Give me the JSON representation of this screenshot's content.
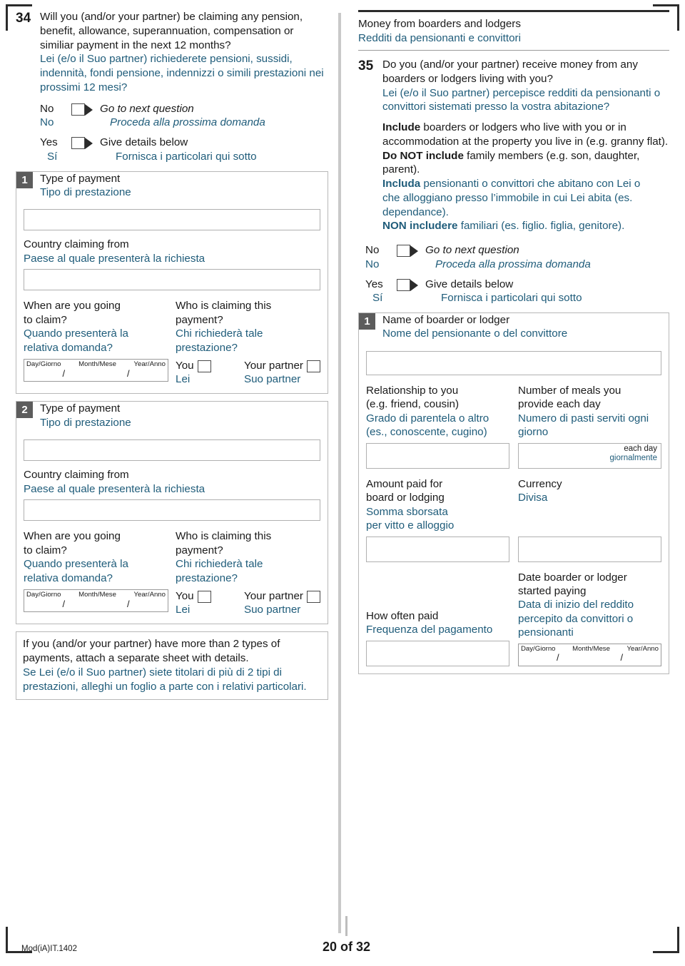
{
  "document": {
    "form_code": "Mod(iA)IT.1402",
    "page_label": "20 of 32"
  },
  "colors": {
    "english_text": "#1a1a1a",
    "italian_text": "#1f5c7a",
    "badge_background": "#5c5c5c",
    "panel_border": "#b8b8b8"
  },
  "left_column": {
    "question": {
      "number": "34",
      "en_line1": "Will you (and/or your partner) be claiming any pension,",
      "en_line2": "benefit, allowance, superannuation, compensation or",
      "en_line3": "similiar payment in the next 12 months?",
      "it_line1": "Lei (e/o il Suo partner) richiederete pensioni, sussidi,",
      "it_line2": "indennità, fondi pensione, indennizzi o simili prestazioni nei",
      "it_line3": "prossimi 12 mesi?"
    },
    "answers": {
      "no_en": "No",
      "no_it": "No",
      "no_action_en": "Go to next question",
      "no_action_it": "Proceda alla prossima domanda",
      "yes_en": "Yes",
      "yes_it": "Sí",
      "yes_action_en": "Give details below",
      "yes_action_it": "Fornisca i particolari qui sotto"
    },
    "entry_1": {
      "badge": "1",
      "type_en": "Type of payment",
      "type_it": "Tipo di prestazione",
      "type_value": "",
      "country_en": "Country claiming from",
      "country_it": "Paese al quale presenterà la richiesta",
      "country_value": "",
      "when_en_line1": "When are you going",
      "when_en_line2": "to claim?",
      "when_it_line1": "Quando presenterà la",
      "when_it_line2": "relativa domanda?",
      "date_day": "Day/Giorno",
      "date_month": "Month/Mese",
      "date_year": "Year/Anno",
      "date_value_day": "",
      "date_value_month": "",
      "date_value_year": "",
      "who_en_line1": "Who is claiming this",
      "who_en_line2": "payment?",
      "who_it_line1": "Chi richiederà tale",
      "who_it_line2": "prestazione?",
      "you_en": "You",
      "you_it": "Lei",
      "partner_en": "Your partner",
      "partner_it": "Suo partner"
    },
    "entry_2": {
      "badge": "2",
      "type_en": "Type of payment",
      "type_it": "Tipo di prestazione",
      "type_value": "",
      "country_en": "Country claiming from",
      "country_it": "Paese al quale presenterà la richiesta",
      "country_value": "",
      "when_en_line1": "When are you going",
      "when_en_line2": "to claim?",
      "when_it_line1": "Quando presenterà la",
      "when_it_line2": "relativa domanda?",
      "date_day": "Day/Giorno",
      "date_month": "Month/Mese",
      "date_year": "Year/Anno",
      "date_value_day": "",
      "date_value_month": "",
      "date_value_year": "",
      "who_en_line1": "Who is claiming this",
      "who_en_line2": "payment?",
      "who_it_line1": "Chi richiederà tale",
      "who_it_line2": "prestazione?",
      "you_en": "You",
      "you_it": "Lei",
      "partner_en": "Your partner",
      "partner_it": "Suo partner"
    },
    "note": {
      "en_line1": "If you (and/or your partner) have more than 2 types of",
      "en_line2": "payments, attach a separate sheet with details.",
      "it_line1": "Se Lei (e/o il Suo partner) siete titolari di più di 2 tipi di",
      "it_line2": "prestazioni, alleghi un foglio a parte con i relativi particolari."
    }
  },
  "right_column": {
    "section": {
      "title_en": "Money from boarders and lodgers",
      "title_it": "Redditi da pensionanti e convittori"
    },
    "question": {
      "number": "35",
      "en_line1": "Do you (and/or your partner) receive money from any",
      "en_line2": "boarders or lodgers living with you?",
      "it_line1": "Lei (e/o il Suo partner) percepisce redditi da pensionanti o",
      "it_line2": "convittori sistemati presso la vostra abitazione?"
    },
    "instructions": {
      "include_bold": "Include",
      "include_rest_line1": " boarders or lodgers who live with you or in",
      "include_rest_line2": "accommodation at the property you live in (e.g. granny flat).",
      "donot_bold": "Do NOT include",
      "donot_rest_line1": " family members (e.g. son, daughter,",
      "donot_rest_line2": "parent).",
      "includa_bold": "Includa",
      "includa_rest_line1": " pensionanti o convittori che abitano con Lei o",
      "includa_rest_line2": "che alloggiano presso l’immobile in cui Lei abita (es.",
      "includa_rest_line3": "dependance).",
      "non_bold": "NON includere",
      "non_rest": " familiari (es. figlio. figlia, genitore)."
    },
    "answers": {
      "no_en": "No",
      "no_it": "No",
      "no_action_en": "Go to next question",
      "no_action_it": "Proceda alla prossima domanda",
      "yes_en": "Yes",
      "yes_it": "Sí",
      "yes_action_en": "Give details below",
      "yes_action_it": "Fornisca i particolari qui sotto"
    },
    "entry_1": {
      "badge": "1",
      "name_en": "Name of boarder or lodger",
      "name_it": "Nome del pensionante o del convittore",
      "name_value": "",
      "relationship_en_line1": "Relationship to you",
      "relationship_en_line2": "(e.g. friend, cousin)",
      "relationship_it_line1": "Grado di parentela o altro",
      "relationship_it_line2": "(es., conoscente, cugino)",
      "relationship_value": "",
      "meals_en_line1": "Number of meals you",
      "meals_en_line2": "provide each day",
      "meals_it_line1": "Numero di pasti serviti ogni",
      "meals_it_line2": "giorno",
      "meals_value": "",
      "meals_unit_en": "each day",
      "meals_unit_it": "giornalmente",
      "amount_en_line1": "Amount paid for",
      "amount_en_line2": "board or lodging",
      "amount_it_line1": "Somma sborsata",
      "amount_it_line2": "per vitto e alloggio",
      "amount_value": "",
      "currency_en": "Currency",
      "currency_it": "Divisa",
      "currency_value": "",
      "howoften_en": "How often paid",
      "howoften_it": "Frequenza del pagamento",
      "howoften_value": "",
      "started_en_line1": "Date boarder or lodger",
      "started_en_line2": "started paying",
      "started_it_line1": "Data di inizio del reddito",
      "started_it_line2": "percepito da convittori o",
      "started_it_line3": "pensionanti",
      "date_day": "Day/Giorno",
      "date_month": "Month/Mese",
      "date_year": "Year/Anno",
      "date_value_day": "",
      "date_value_month": "",
      "date_value_year": ""
    }
  }
}
